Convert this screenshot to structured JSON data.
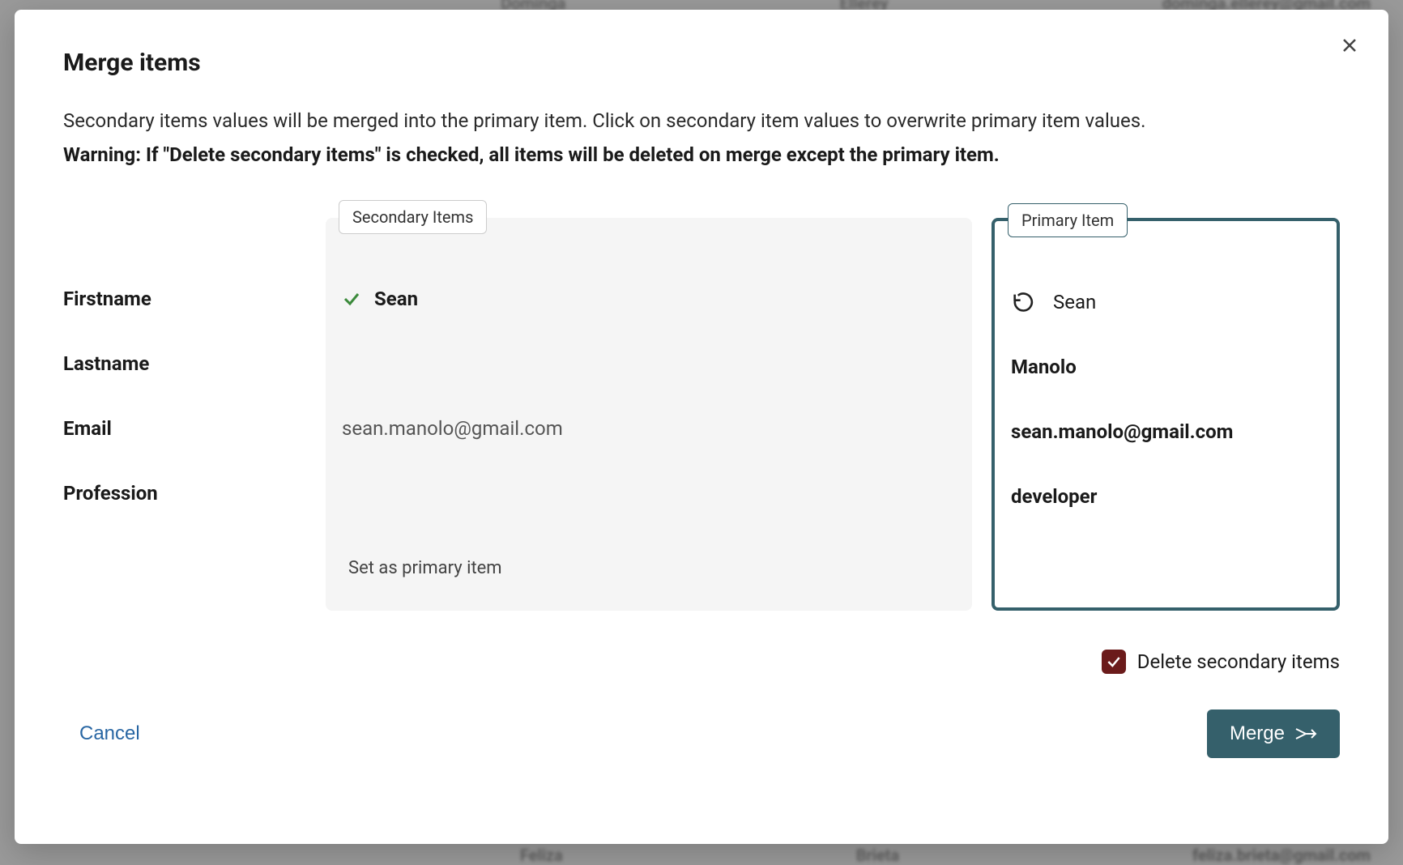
{
  "background": {
    "top_row": {
      "firstname": "Dominga",
      "lastname": "Ellerey",
      "email": "dominga.ellerey@gmail.com"
    },
    "bottom_row": {
      "firstname": "Feliza",
      "lastname": "Brieta",
      "email": "feliza.brieta@gmail.com"
    }
  },
  "dialog": {
    "title": "Merge items",
    "description": "Secondary items values will be merged into the primary item. Click on secondary item values to overwrite primary item values.",
    "warning": "Warning: If \"Delete secondary items\" is checked, all items will be deleted on merge except the primary item.",
    "secondary_tag": "Secondary Items",
    "primary_tag": "Primary Item",
    "fields": {
      "firstname_label": "Firstname",
      "lastname_label": "Lastname",
      "email_label": "Email",
      "profession_label": "Profession"
    },
    "secondary": {
      "firstname": "Sean",
      "lastname": "",
      "email": "sean.manolo@gmail.com",
      "profession": "",
      "set_primary": "Set as primary item"
    },
    "primary": {
      "firstname": "Sean",
      "lastname": "Manolo",
      "email": "sean.manolo@gmail.com",
      "profession": "developer"
    },
    "delete_secondary_label": "Delete secondary items",
    "delete_secondary_checked": true,
    "cancel_label": "Cancel",
    "merge_label": "Merge"
  }
}
